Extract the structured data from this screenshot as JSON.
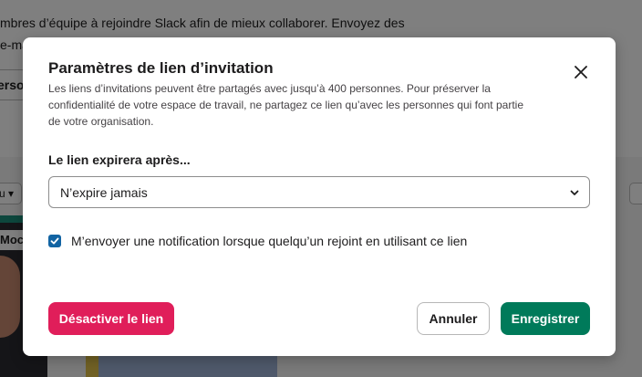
{
  "background": {
    "title": "",
    "line1": "mbres d’équipe à rejoindre Slack afin de mieux collaborer. Envoyez des",
    "line2": "e-ma",
    "button_label": "ersor",
    "filter_label": "u ▾",
    "card_tag": "Moc"
  },
  "modal": {
    "title": "Paramètres de lien d’invitation",
    "description": "Les liens d’invitations peuvent être partagés avec jusqu’à 400 personnes. Pour préserver la confidentialité de votre espace de travail, ne partagez ce lien qu’avec les personnes qui font partie de votre organisation.",
    "close_icon": "close-icon",
    "expire_label": "Le lien expirera après...",
    "expire_select": {
      "value": "N’expire jamais"
    },
    "notify_checkbox": {
      "checked": true,
      "label": "M’envoyer une notification lorsque quelqu’un rejoint en utilisant ce lien"
    },
    "buttons": {
      "deactivate": "Désactiver le lien",
      "cancel": "Annuler",
      "save": "Enregistrer"
    }
  },
  "colors": {
    "danger": "#e01e5a",
    "primary": "#007a5a",
    "checkbox": "#1264a3"
  }
}
